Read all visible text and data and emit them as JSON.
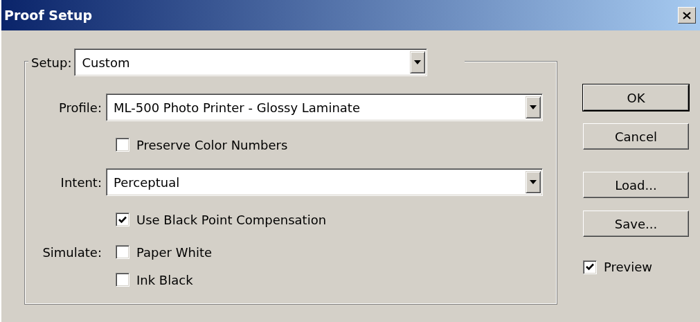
{
  "window": {
    "title": "Proof Setup"
  },
  "setup": {
    "label": "Setup:",
    "value": "Custom"
  },
  "rows": [
    {
      "kind": "dropdown",
      "label": "Profile:",
      "value": "ML-500 Photo Printer - Glossy Laminate"
    },
    {
      "kind": "checkbox",
      "text": "Preserve Color Numbers",
      "checked": false
    },
    {
      "kind": "dropdown",
      "label": "Intent:",
      "value": "Perceptual"
    },
    {
      "kind": "checkbox",
      "text": "Use Black Point Compensation",
      "checked": true
    },
    {
      "kind": "checkbox",
      "label": "Simulate:",
      "text": "Paper White",
      "checked": false
    },
    {
      "kind": "checkbox",
      "text": "Ink Black",
      "checked": false
    }
  ],
  "buttons": [
    {
      "label": "OK",
      "default": true
    },
    {
      "label": "Cancel",
      "default": false
    },
    {
      "label": "Load...",
      "default": false
    },
    {
      "label": "Save...",
      "default": false
    }
  ],
  "preview": {
    "text": "Preview",
    "checked": true
  }
}
